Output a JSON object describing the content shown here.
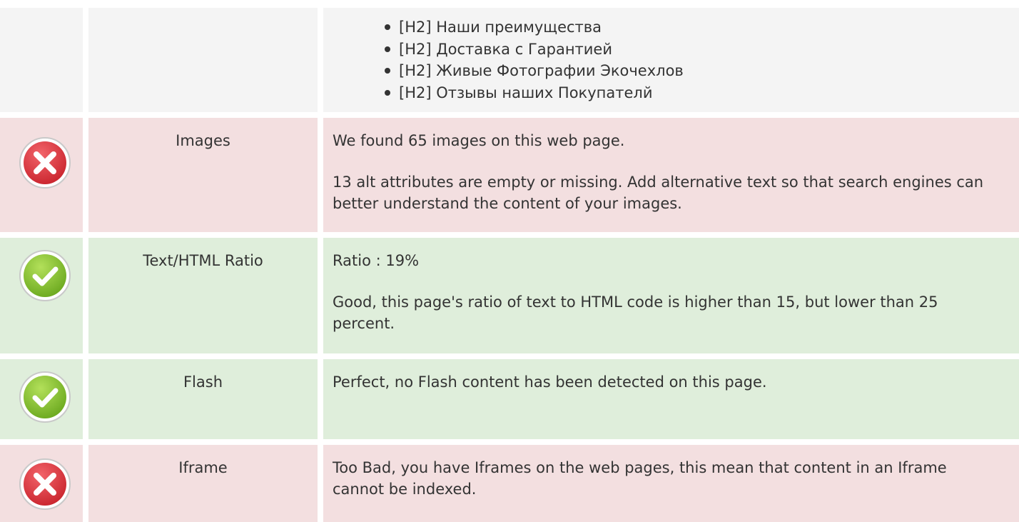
{
  "headings_row": {
    "items": [
      "[H2] Наши преимущества",
      "[H2] Доставка с Гарантией",
      "[H2] Живые Фотографии Экочехлов",
      "[H2] Отзывы наших Покупателй"
    ]
  },
  "rows": {
    "images": {
      "status": "error",
      "label": "Images",
      "line1": "We found 65 images on this web page.",
      "line2": "13 alt attributes are empty or missing. Add alternative text so that search engines can better understand the content of your images."
    },
    "ratio": {
      "status": "ok",
      "label": "Text/HTML Ratio",
      "line1": "Ratio : 19%",
      "line2": "Good, this page's ratio of text to HTML code is higher than 15, but lower than 25 percent."
    },
    "flash": {
      "status": "ok",
      "label": "Flash",
      "line1": "Perfect, no Flash content has been detected on this page."
    },
    "iframe": {
      "status": "error",
      "label": "Iframe",
      "line1": "Too Bad, you have Iframes on the web pages, this mean that content in an Iframe cannot be indexed."
    }
  },
  "icons": {
    "error": "error-x-icon",
    "ok": "check-icon"
  },
  "colors": {
    "bad_bg": "#f3dfe0",
    "good_bg": "#dfeedb",
    "neutral_bg": "#f4f4f4",
    "error_red": "#d9303a",
    "ok_green": "#8cc63f",
    "text": "#333333"
  }
}
